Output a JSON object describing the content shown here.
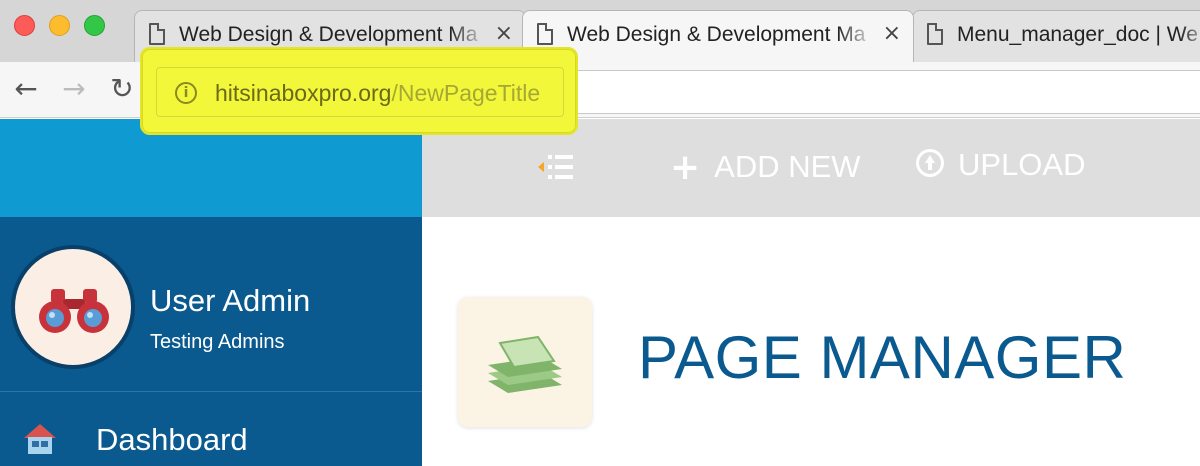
{
  "browser": {
    "tabs": [
      {
        "title": "Web Design & Development Ma",
        "active": false
      },
      {
        "title": "Web Design & Development Ma",
        "active": true
      },
      {
        "title": "Menu_manager_doc | We",
        "active": false
      }
    ],
    "close_glyph": "×",
    "url_host": "hitsinaboxpro.org",
    "url_path": "/NewPageTitle",
    "highlight_color": "#f3f73a"
  },
  "icons": {
    "back": "arrow-left-icon",
    "forward": "arrow-right-icon",
    "reload": "reload-icon",
    "info": "info-icon",
    "menu_toggle": "menu-collapse-icon",
    "add": "plus-icon",
    "upload": "upload-icon",
    "house": "house-icon",
    "binoculars": "binoculars-icon",
    "pages": "pages-stack-icon"
  },
  "sidebar": {
    "user_name": "User Admin",
    "user_role": "Testing Admins",
    "nav": [
      {
        "label": "Dashboard"
      }
    ]
  },
  "actionbar": {
    "add_new": "ADD NEW",
    "upload": "UPLOAD"
  },
  "main": {
    "title": "PAGE MANAGER"
  },
  "colors": {
    "sidebar_top": "#0f9bd1",
    "sidebar_user": "#0a5a8f",
    "actionbar_bg": "#dedede",
    "title": "#0a5a8f",
    "accent_orange": "#f5a623"
  }
}
